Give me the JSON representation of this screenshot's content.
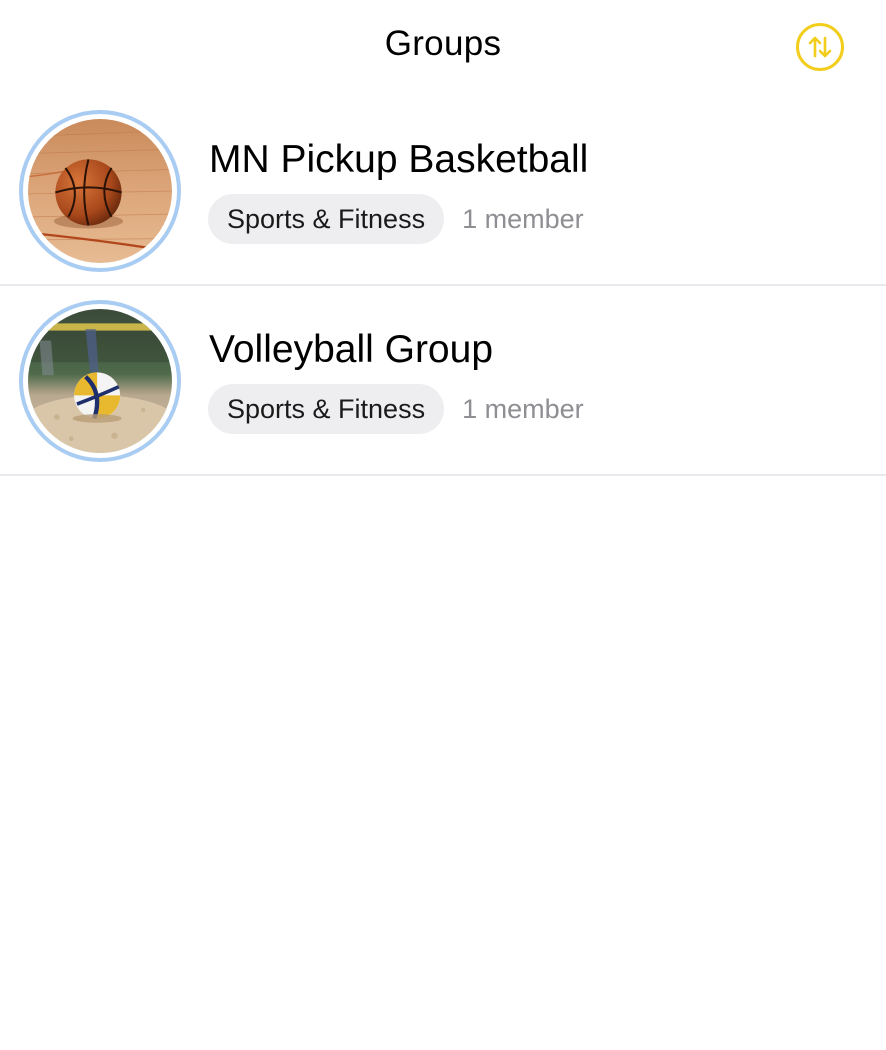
{
  "header": {
    "title": "Groups",
    "sort_icon": "sort-arrows-icon",
    "accent_color": "#f2cd1c"
  },
  "groups": [
    {
      "name": "MN Pickup Basketball",
      "category": "Sports & Fitness",
      "members": "1 member",
      "avatar": "basketball-photo"
    },
    {
      "name": "Volleyball Group",
      "category": "Sports & Fitness",
      "members": "1 member",
      "avatar": "volleyball-photo"
    }
  ],
  "colors": {
    "avatar_ring": "#a9ccf3",
    "pill_background": "#eeeef0",
    "secondary_text": "#8e8e93",
    "divider": "#e9e9ee"
  }
}
